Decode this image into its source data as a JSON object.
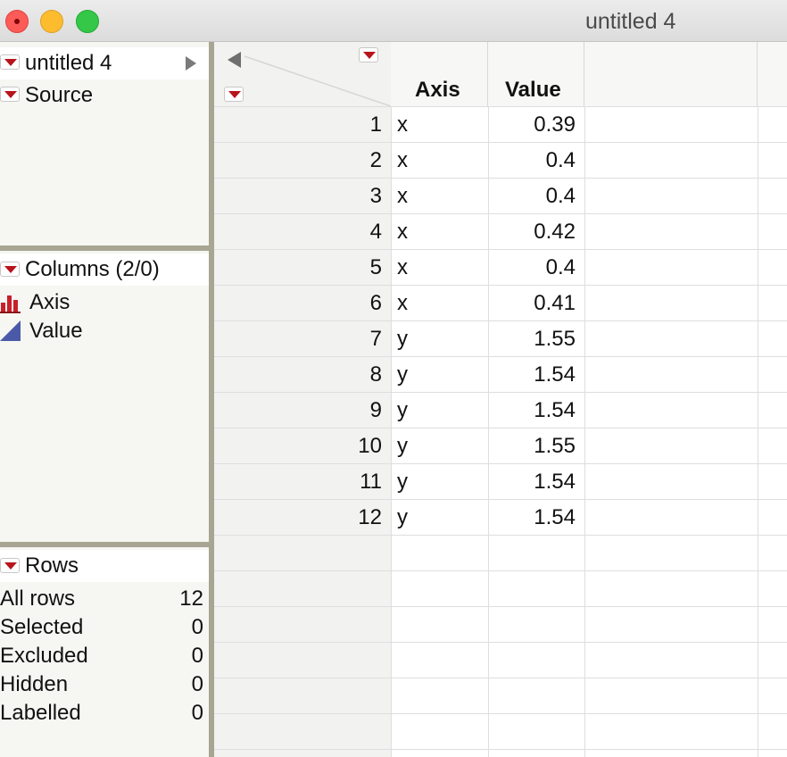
{
  "window": {
    "title": "untitled 4"
  },
  "left_panel": {
    "table_name": "untitled 4",
    "source_label": "Source",
    "columns_header": "Columns (2/0)",
    "columns": [
      {
        "name": "Axis",
        "icon": "nominal-bar-icon"
      },
      {
        "name": "Value",
        "icon": "continuous-triangle-icon"
      }
    ],
    "rows_header": "Rows",
    "rows_stats": [
      {
        "label": "All rows",
        "value": "12"
      },
      {
        "label": "Selected",
        "value": "0"
      },
      {
        "label": "Excluded",
        "value": "0"
      },
      {
        "label": "Hidden",
        "value": "0"
      },
      {
        "label": "Labelled",
        "value": "0"
      }
    ]
  },
  "table": {
    "headers": [
      "Axis",
      "Value"
    ],
    "rows": [
      {
        "num": "1",
        "axis": "x",
        "value": "0.39"
      },
      {
        "num": "2",
        "axis": "x",
        "value": "0.4"
      },
      {
        "num": "3",
        "axis": "x",
        "value": "0.4"
      },
      {
        "num": "4",
        "axis": "x",
        "value": "0.42"
      },
      {
        "num": "5",
        "axis": "x",
        "value": "0.4"
      },
      {
        "num": "6",
        "axis": "x",
        "value": "0.41"
      },
      {
        "num": "7",
        "axis": "y",
        "value": "1.55"
      },
      {
        "num": "8",
        "axis": "y",
        "value": "1.54"
      },
      {
        "num": "9",
        "axis": "y",
        "value": "1.54"
      },
      {
        "num": "10",
        "axis": "y",
        "value": "1.55"
      },
      {
        "num": "11",
        "axis": "y",
        "value": "1.54"
      },
      {
        "num": "12",
        "axis": "y",
        "value": "1.54"
      }
    ]
  },
  "colors": {
    "accent_red": "#b8141c",
    "splitter": "#a8a693"
  }
}
